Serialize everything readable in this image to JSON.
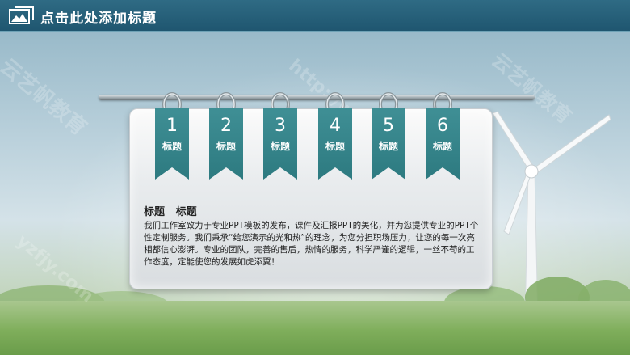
{
  "header": {
    "title": "点击此处添加标题",
    "icon": "slide-icon"
  },
  "tags": [
    {
      "number": "1",
      "label": "标题"
    },
    {
      "number": "2",
      "label": "标题"
    },
    {
      "number": "3",
      "label": "标题"
    },
    {
      "number": "4",
      "label": "标题"
    },
    {
      "number": "5",
      "label": "标题"
    },
    {
      "number": "6",
      "label": "标题"
    }
  ],
  "content": {
    "heading": "标题   标题",
    "body": "我们工作室致力于专业PPT模板的发布，课件及汇报PPT的美化，并为您提供专业的PPT个性定制服务。我们秉承“给您演示的光和热”的理念，为您分担职场压力，让您的每一次亮相都信心澎湃。专业的团队，完善的售后，热情的服务，科学严谨的逻辑，一丝不苟的工作态度，定能使您的发展如虎添翼！"
  },
  "watermarks": {
    "w1": "云艺帆教育",
    "w2": "http://www.yzfjy.com",
    "w3": "yzfjy.com",
    "w4": "云艺帆教育"
  },
  "colors": {
    "header": "#2a6480",
    "tag": "#3a8a90",
    "accent": "#ffffff"
  }
}
